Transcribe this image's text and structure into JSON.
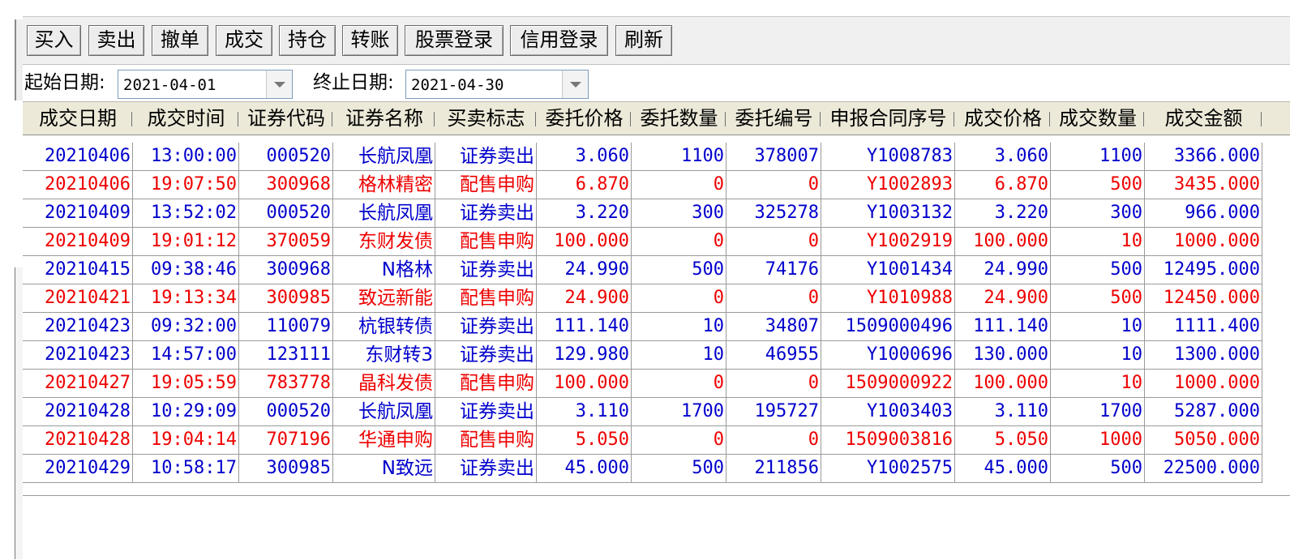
{
  "toolbar": {
    "buttons": [
      "买入",
      "卖出",
      "撤单",
      "成交",
      "持仓",
      "转账",
      "股票登录",
      "信用登录",
      "刷新"
    ]
  },
  "filters": {
    "start_label": "起始日期:",
    "start_value": "2021-04-01",
    "end_label": "终止日期:",
    "end_value": "2021-04-30"
  },
  "table": {
    "headers": [
      "成交日期",
      "成交时间",
      "证券代码",
      "证券名称",
      "买卖标志",
      "委托价格",
      "委托数量",
      "委托编号",
      "申报合同序号",
      "成交价格",
      "成交数量",
      "成交金额"
    ],
    "colors": {
      "sell": "#0000cc",
      "buy": "#ee0000"
    },
    "rows": [
      {
        "color": "blue",
        "cells": [
          "20210406",
          "13:00:00",
          "000520",
          "长航凤凰",
          "证券卖出",
          "3.060",
          "1100",
          "378007",
          "Y1008783",
          "3.060",
          "1100",
          "3366.000"
        ]
      },
      {
        "color": "red",
        "cells": [
          "20210406",
          "19:07:50",
          "300968",
          "格林精密",
          "配售申购",
          "6.870",
          "0",
          "0",
          "Y1002893",
          "6.870",
          "500",
          "3435.000"
        ]
      },
      {
        "color": "blue",
        "cells": [
          "20210409",
          "13:52:02",
          "000520",
          "长航凤凰",
          "证券卖出",
          "3.220",
          "300",
          "325278",
          "Y1003132",
          "3.220",
          "300",
          "966.000"
        ]
      },
      {
        "color": "red",
        "cells": [
          "20210409",
          "19:01:12",
          "370059",
          "东财发债",
          "配售申购",
          "100.000",
          "0",
          "0",
          "Y1002919",
          "100.000",
          "10",
          "1000.000"
        ]
      },
      {
        "color": "blue",
        "cells": [
          "20210415",
          "09:38:46",
          "300968",
          "N格林",
          "证券卖出",
          "24.990",
          "500",
          "74176",
          "Y1001434",
          "24.990",
          "500",
          "12495.000"
        ]
      },
      {
        "color": "red",
        "cells": [
          "20210421",
          "19:13:34",
          "300985",
          "致远新能",
          "配售申购",
          "24.900",
          "0",
          "0",
          "Y1010988",
          "24.900",
          "500",
          "12450.000"
        ]
      },
      {
        "color": "blue",
        "cells": [
          "20210423",
          "09:32:00",
          "110079",
          "杭银转债",
          "证券卖出",
          "111.140",
          "10",
          "34807",
          "1509000496",
          "111.140",
          "10",
          "1111.400"
        ]
      },
      {
        "color": "blue",
        "cells": [
          "20210423",
          "14:57:00",
          "123111",
          "东财转3",
          "证券卖出",
          "129.980",
          "10",
          "46955",
          "Y1000696",
          "130.000",
          "10",
          "1300.000"
        ]
      },
      {
        "color": "red",
        "cells": [
          "20210427",
          "19:05:59",
          "783778",
          "晶科发债",
          "配售申购",
          "100.000",
          "0",
          "0",
          "1509000922",
          "100.000",
          "10",
          "1000.000"
        ]
      },
      {
        "color": "blue",
        "cells": [
          "20210428",
          "10:29:09",
          "000520",
          "长航凤凰",
          "证券卖出",
          "3.110",
          "1700",
          "195727",
          "Y1003403",
          "3.110",
          "1700",
          "5287.000"
        ]
      },
      {
        "color": "red",
        "cells": [
          "20210428",
          "19:04:14",
          "707196",
          "华通申购",
          "配售申购",
          "5.050",
          "0",
          "0",
          "1509003816",
          "5.050",
          "1000",
          "5050.000"
        ]
      },
      {
        "color": "blue",
        "cells": [
          "20210429",
          "10:58:17",
          "300985",
          "N致远",
          "证券卖出",
          "45.000",
          "500",
          "211856",
          "Y1002575",
          "45.000",
          "500",
          "22500.000"
        ]
      }
    ]
  }
}
